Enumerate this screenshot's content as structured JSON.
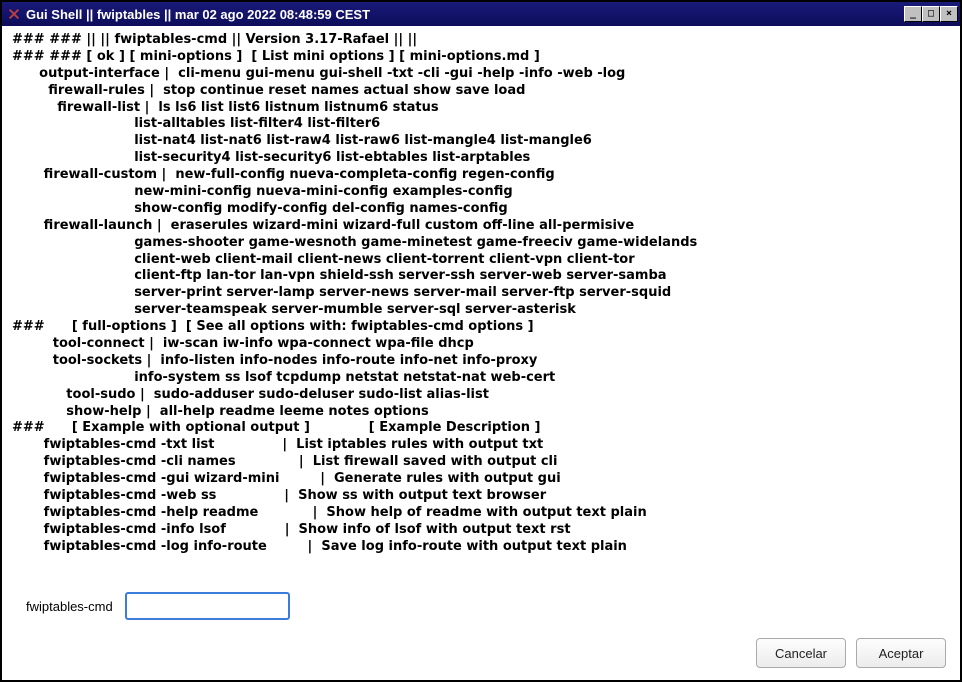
{
  "titlebar": {
    "title": "Gui Shell || fwiptables || mar 02 ago 2022 08:48:59 CEST"
  },
  "lines": [
    "### ### || || fwiptables-cmd || Version 3.17-Rafael || ||",
    "### ### [ ok ] [ mini-options ]  [ List mini options ] [ mini-options.md ]",
    "      output-interface |  cli-menu gui-menu gui-shell -txt -cli -gui -help -info -web -log",
    "        firewall-rules |  stop continue reset names actual show save load",
    "          firewall-list |  ls ls6 list list6 listnum listnum6 status",
    "                           list-alltables list-filter4 list-filter6",
    "                           list-nat4 list-nat6 list-raw4 list-raw6 list-mangle4 list-mangle6",
    "                           list-security4 list-security6 list-ebtables list-arptables",
    "       firewall-custom |  new-full-config nueva-completa-config regen-config",
    "                           new-mini-config nueva-mini-config examples-config",
    "                           show-config modify-config del-config names-config",
    "       firewall-launch |  eraserules wizard-mini wizard-full custom off-line all-permisive",
    "                           games-shooter game-wesnoth game-minetest game-freeciv game-widelands",
    "                           client-web client-mail client-news client-torrent client-vpn client-tor",
    "                           client-ftp lan-tor lan-vpn shield-ssh server-ssh server-web server-samba",
    "                           server-print server-lamp server-news server-mail server-ftp server-squid",
    "                           server-teamspeak server-mumble server-sql server-asterisk",
    "###      [ full-options ]  [ See all options with: fwiptables-cmd options ]",
    "         tool-connect |  iw-scan iw-info wpa-connect wpa-file dhcp",
    "         tool-sockets |  info-listen info-nodes info-route info-net info-proxy",
    "                           info-system ss lsof tcpdump netstat netstat-nat web-cert",
    "            tool-sudo |  sudo-adduser sudo-deluser sudo-list alias-list",
    "            show-help |  all-help readme leeme notes options",
    "###      [ Example with optional output ]             [ Example Description ]",
    "       fwiptables-cmd -txt list               |  List iptables rules with output txt",
    "       fwiptables-cmd -cli names              |  List firewall saved with output cli",
    "       fwiptables-cmd -gui wizard-mini         |  Generate rules with output gui",
    "       fwiptables-cmd -web ss               |  Show ss with output text browser",
    "       fwiptables-cmd -help readme            |  Show help of readme with output text plain",
    "       fwiptables-cmd -info lsof             |  Show info of lsof with output text rst",
    "       fwiptables-cmd -log info-route         |  Save log info-route with output text plain"
  ],
  "input": {
    "label": "fwiptables-cmd",
    "value": ""
  },
  "buttons": {
    "cancel": "Cancelar",
    "accept": "Aceptar"
  }
}
